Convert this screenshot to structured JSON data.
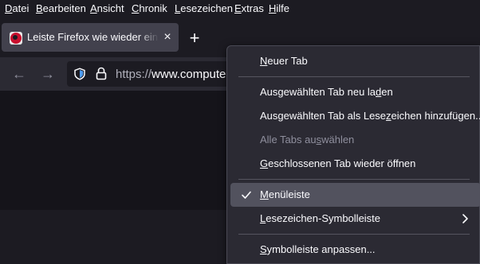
{
  "menubar": {
    "items": [
      {
        "pre": "",
        "key": "D",
        "post": "atei"
      },
      {
        "pre": "",
        "key": "B",
        "post": "earbeiten"
      },
      {
        "pre": "",
        "key": "A",
        "post": "nsicht"
      },
      {
        "pre": "",
        "key": "C",
        "post": "hronik"
      },
      {
        "pre": "",
        "key": "L",
        "post": "esezeichen"
      },
      {
        "pre": "",
        "key": "E",
        "post": "xtras"
      },
      {
        "pre": "",
        "key": "H",
        "post": "ilfe"
      }
    ]
  },
  "tab": {
    "title": "Leiste Firefox wie wieder einstellen",
    "close_glyph": "×",
    "favicon_letters": "CB"
  },
  "new_tab_glyph": "+",
  "navbar": {
    "back_glyph": "←",
    "forward_glyph": "→",
    "url_protocol": "https://",
    "url_host": "www.computerbase.de"
  },
  "context_menu": {
    "items": [
      {
        "pre": "",
        "key": "N",
        "post": "euer Tab",
        "disabled": false,
        "checked": false,
        "submenu": false
      },
      {
        "pre": "Ausgewählten Tab neu la",
        "key": "d",
        "post": "en",
        "disabled": false,
        "checked": false,
        "submenu": false
      },
      {
        "pre": "Ausgewählten Tab als Lese",
        "key": "z",
        "post": "eichen hinzufügen...",
        "disabled": false,
        "checked": false,
        "submenu": false
      },
      {
        "pre": "Alle Tabs au",
        "key": "s",
        "post": "wählen",
        "disabled": true,
        "checked": false,
        "submenu": false
      },
      {
        "pre": "",
        "key": "G",
        "post": "eschlossenen Tab wieder öffnen",
        "disabled": false,
        "checked": false,
        "submenu": false
      },
      {
        "pre": "",
        "key": "M",
        "post": "enüleiste",
        "disabled": false,
        "checked": true,
        "submenu": false
      },
      {
        "pre": "",
        "key": "L",
        "post": "esezeichen-Symbolleiste",
        "disabled": false,
        "checked": false,
        "submenu": true
      },
      {
        "pre": "",
        "key": "S",
        "post": "ymbolleiste anpassen...",
        "disabled": false,
        "checked": false,
        "submenu": false
      }
    ]
  }
}
